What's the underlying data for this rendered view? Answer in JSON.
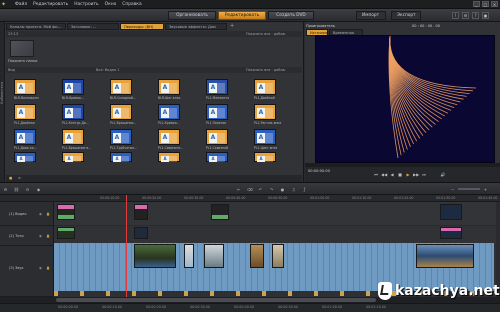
{
  "menubar": {
    "items": [
      "Файл",
      "Редактировать",
      "Настроить",
      "Окно",
      "Справка"
    ],
    "window_controls": [
      "_",
      "□",
      "×"
    ]
  },
  "toolbar": {
    "tabs": [
      "Организовать",
      "Редактировать",
      "Создать DVD"
    ],
    "active_tab": "Редактировать",
    "right_buttons": [
      "Импорт",
      "Экспорт"
    ]
  },
  "library": {
    "tabs": [
      "Каналы проекта: Мой фи...",
      "Заголовок: ...",
      "Переходы: (BH)",
      "Звуковые эффекты: Дом"
    ],
    "active_tab": "Переходы: (BH)",
    "subheader_count": "23:13",
    "subheader_right": "Показать все · добав.",
    "tree_thumb_label": "Показать папки",
    "category_label": "Вид",
    "category_center": "Все: Видео 1",
    "category_right": "Показать все · добав.",
    "grid": [
      [
        "BLR-Волноволн",
        "BLR-Кривая...",
        "BLR-Складной...",
        "BLR-Шаг-вниз",
        "PL1-Меняются",
        "PL1-Двойной"
      ],
      [
        "PL1-Двойная",
        "PL1-Контур-Дв...",
        "PL1-Вращение...",
        "PL1-Кривая...",
        "PL1-Перенос",
        "PL1-Растяж-вниз"
      ],
      [
        "PL1-Двое-ко...",
        "PL1-Вращение в...",
        "PL1-Трубчатые...",
        "PL1-Сверните...",
        "PL1-Сквозной",
        "PL1-Цвет-вниз"
      ],
      [
        "",
        "",
        "",
        "",
        "",
        ""
      ]
    ],
    "status": ""
  },
  "preview": {
    "tabs": [
      "Источник",
      "Временная шкала"
    ],
    "active_tab": "Источник",
    "header_label": "Проигрыватель",
    "header_time": "00 : 00 : 00 . 00",
    "timecode": "00:00:00.00",
    "controls": [
      "⏮",
      "◀◀",
      "◀",
      "■",
      "▶",
      "▶▶",
      "⏭",
      "🔊"
    ]
  },
  "timeline": {
    "ruler_ticks": [
      "",
      "00:00:10.00",
      "00:00:20.00",
      "00:00:30.00",
      "00:00:40.00",
      "00:00:50.00",
      "00:01:00.00",
      "00:01:10.00",
      "00:01:20.00",
      "00:01:30.00",
      "00:01:40.00"
    ],
    "tracks": [
      {
        "name": "(1) Видео"
      },
      {
        "name": "(2) Титр"
      },
      {
        "name": "(3) Звук"
      }
    ],
    "footer_ticks": [
      "00:00:00.00",
      "00:00:10.00",
      "00:00:20.00",
      "00:00:30.00",
      "00:00:40.00",
      "00:00:50.00",
      "00:01:00.00",
      "00:01:10.00"
    ]
  },
  "watermark": {
    "brand": "kazachya",
    "dot": ".",
    "tld": "net"
  },
  "colors": {
    "accent": "#e8a033",
    "panel": "#323337",
    "preview_bg": "#0a0733",
    "curve": "#f0a060",
    "clip_blue": "#6f9ac2"
  }
}
